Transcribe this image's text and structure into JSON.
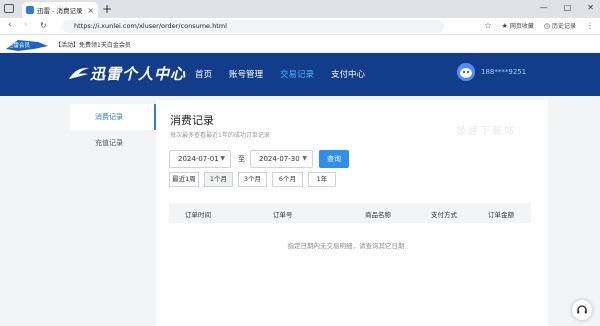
{
  "browser": {
    "tab_title": "迅雷 - 消费记录",
    "tab_close": "×",
    "new_tab": "+",
    "url": "https://i.xunlei.com/xluser/order/consume.html",
    "tools": {
      "favorites": "网页收藏",
      "history": "历史记录"
    },
    "window_buttons": [
      "—",
      "□",
      "✕"
    ]
  },
  "promo": {
    "logo_text": "迅雷会员",
    "text": "【活动】免费领1天白金会员"
  },
  "header": {
    "brand": "迅雷个人中心",
    "nav": [
      {
        "label": "首页"
      },
      {
        "label": "账号管理"
      },
      {
        "label": "交易记录"
      },
      {
        "label": "支付中心"
      }
    ],
    "user_phone": "188****9251"
  },
  "sidebar": {
    "items": [
      {
        "label": "消费记录"
      },
      {
        "label": "充值记录"
      }
    ]
  },
  "page": {
    "title": "消费记录",
    "subtitle": "每次最多查看最近1年的成功订单记录",
    "watermark": "极速下载站",
    "date_start": "2024-07-01",
    "date_end": "2024-07-30",
    "to_label": "至",
    "query_label": "查询",
    "quick_ranges": [
      "最近1周",
      "1个月",
      "3个月",
      "6个月",
      "1年"
    ],
    "table_headers": [
      "订单时间",
      "订单号",
      "商品名称",
      "支付方式",
      "订单金额"
    ],
    "empty_message": "指定日期内无交易明细，请查询其它日期"
  },
  "colors": {
    "header_bg": "#123d8a",
    "accent": "#2e8ff0",
    "active_nav": "#4fb0ff"
  }
}
